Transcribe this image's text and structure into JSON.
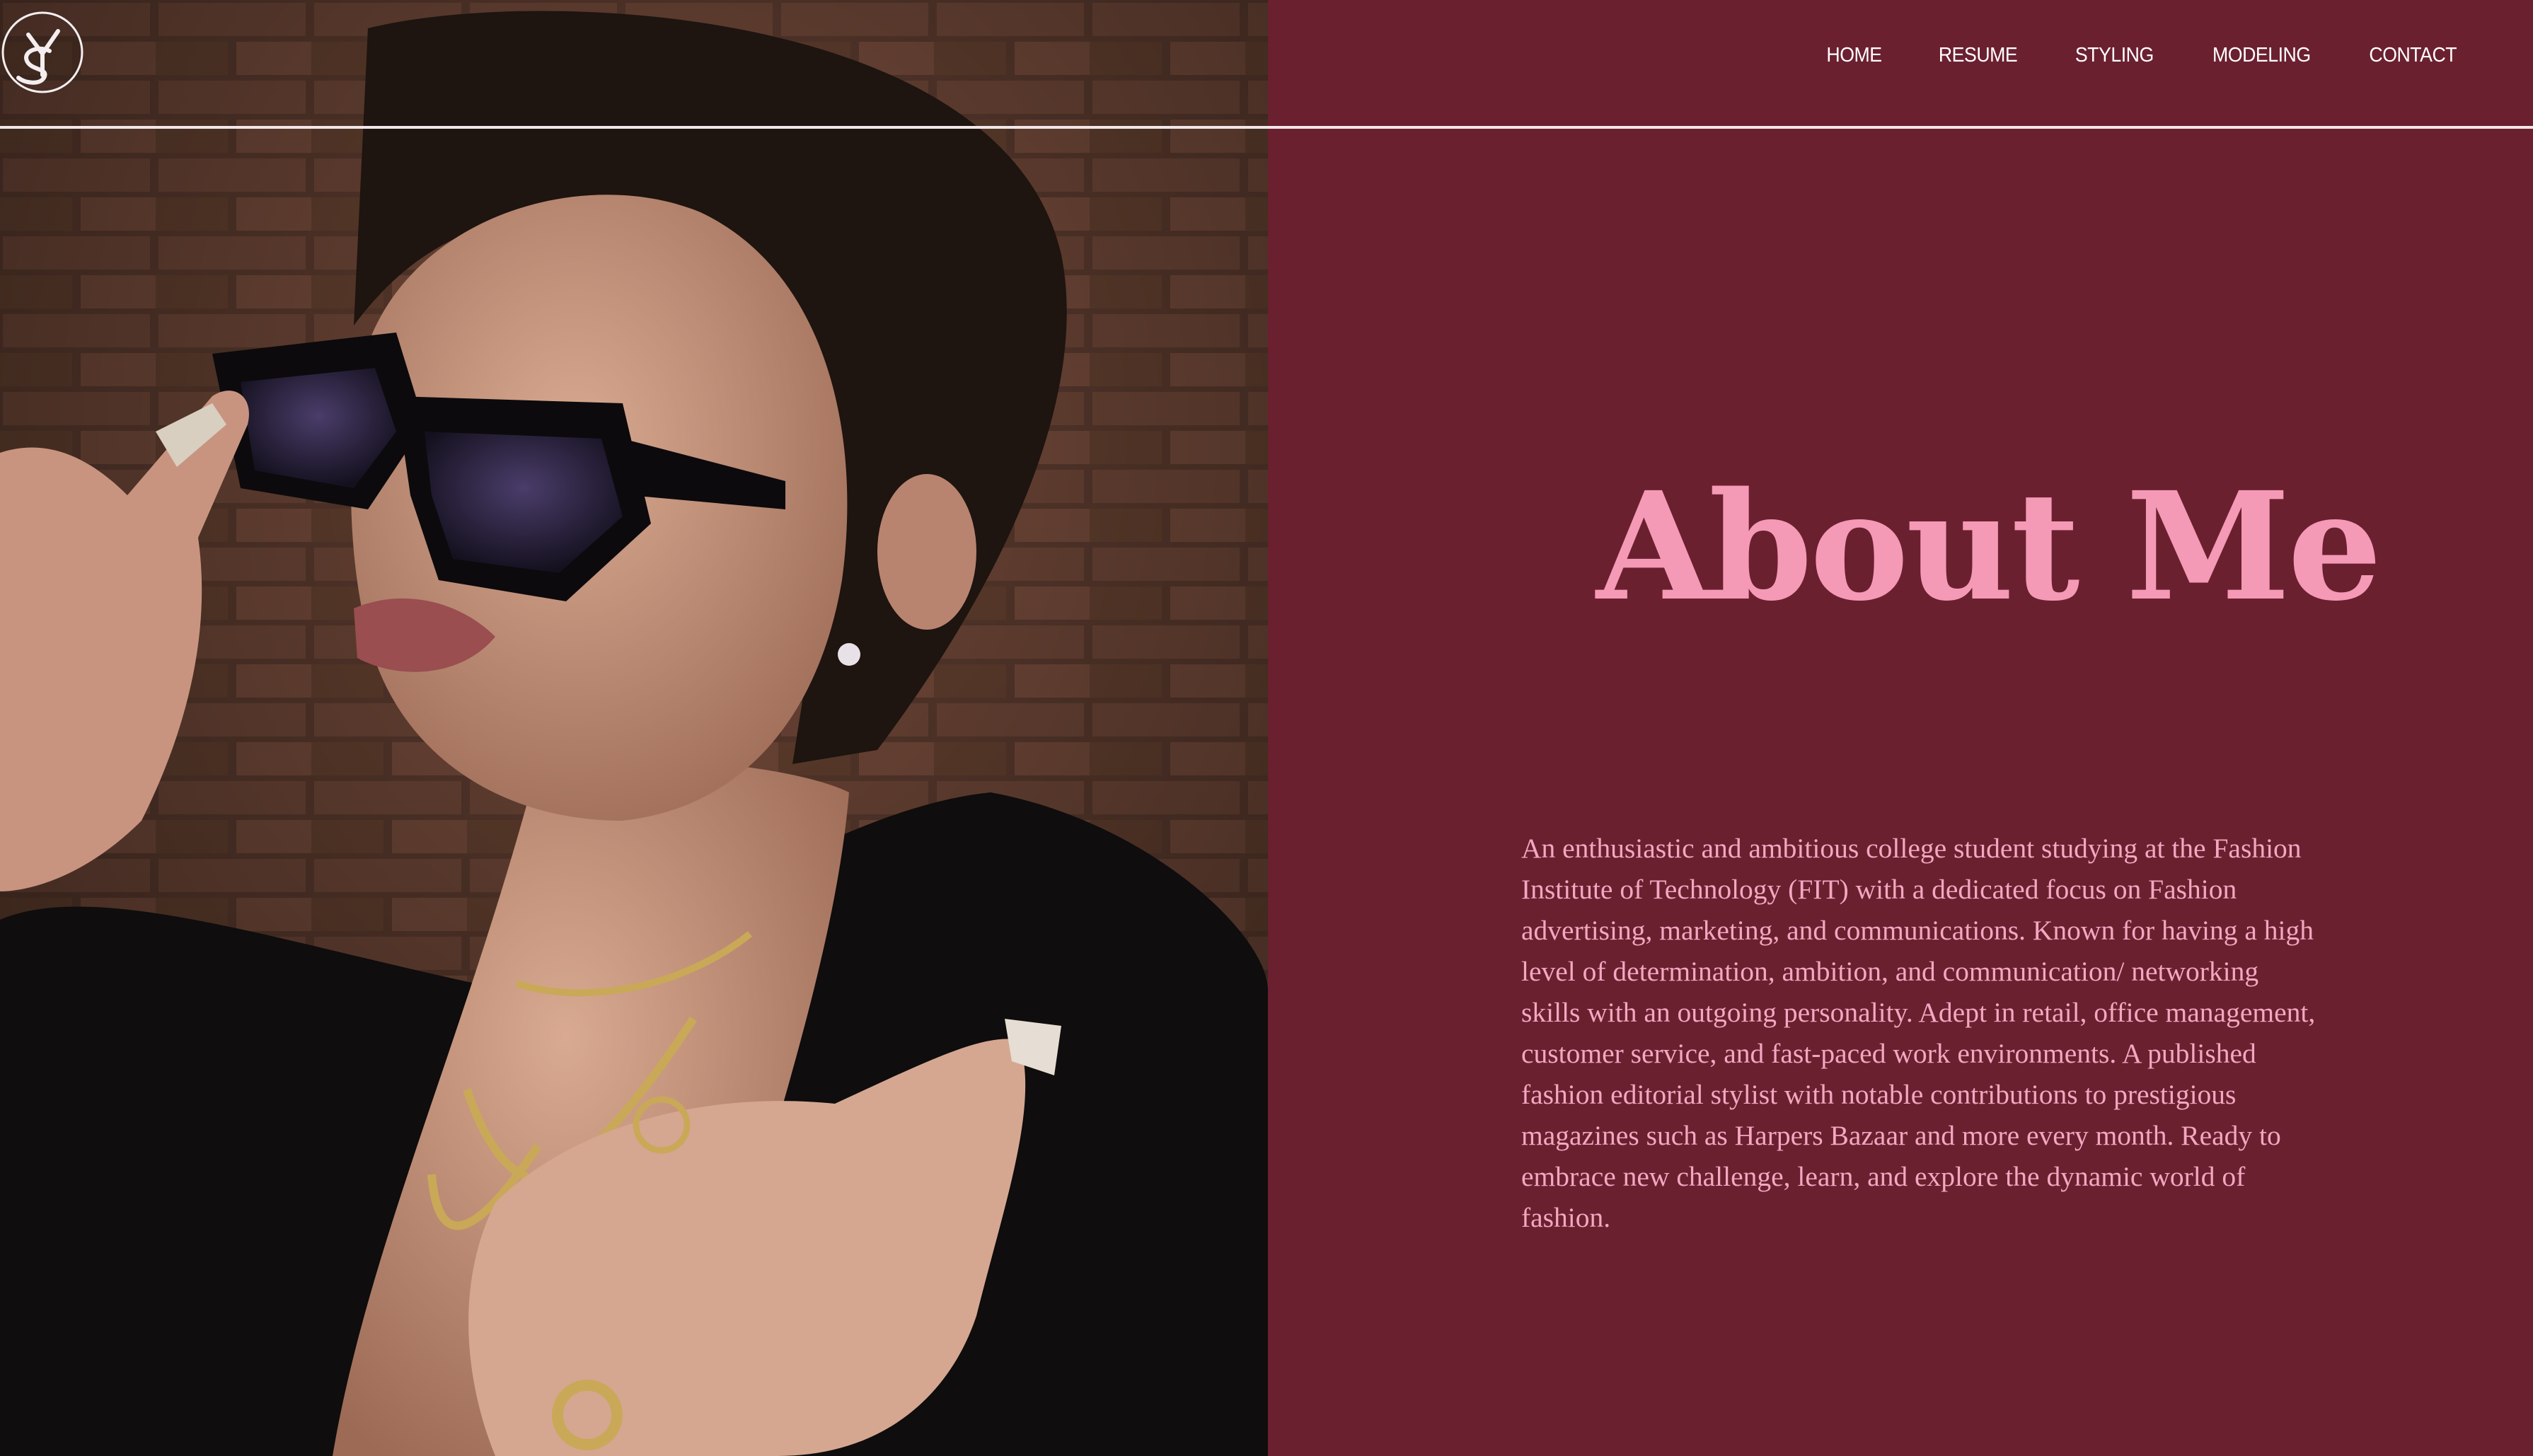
{
  "header": {
    "logo_alt": "SY monogram logo",
    "nav": [
      {
        "label": "HOME"
      },
      {
        "label": "RESUME"
      },
      {
        "label": "STYLING"
      },
      {
        "label": "MODELING"
      },
      {
        "label": "CONTACT"
      }
    ]
  },
  "about": {
    "title": "About Me",
    "body": "An enthusiastic and ambitious college student studying at the Fashion Institute of Technology (FIT) with a dedicated focus on Fashion advertising, marketing, and communications. Known for having a high level of determination, ambition, and communication/ networking skills with an outgoing personality. Adept in retail, office management, customer service, and fast-paced work environments. A published fashion editorial stylist with notable contributions to prestigious magazines such as Harpers Bazaar and more every month. Ready to embrace new challenge, learn, and explore the dynamic world of fashion."
  },
  "colors": {
    "panel_background": "#6b2030",
    "title_pink": "#f59ab6",
    "body_pink": "#f3a7c0",
    "nav_text": "#ffffff"
  }
}
